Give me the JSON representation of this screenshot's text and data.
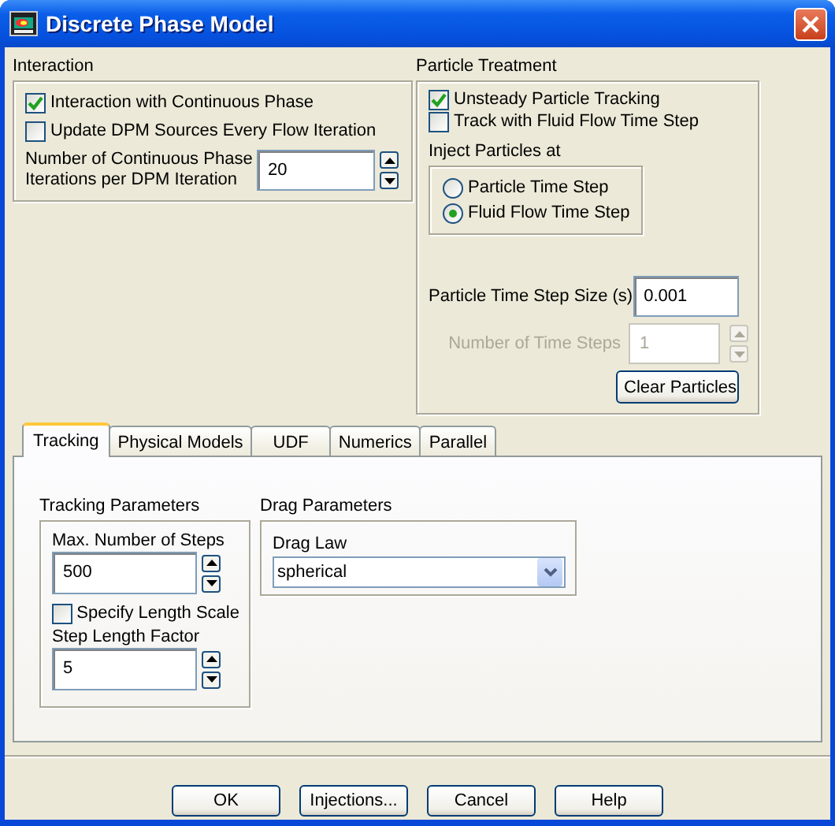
{
  "window": {
    "title": "Discrete Phase Model"
  },
  "interaction": {
    "title": "Interaction",
    "options": [
      {
        "label": "Interaction with Continuous Phase",
        "checked": true
      },
      {
        "label": "Update DPM Sources Every Flow Iteration",
        "checked": false
      }
    ],
    "iterations": {
      "label": "Number of Continuous Phase Iterations per DPM Iteration",
      "value": "20"
    }
  },
  "particle_treatment": {
    "title": "Particle Treatment",
    "options": [
      {
        "label": "Unsteady Particle Tracking",
        "checked": true
      },
      {
        "label": "Track with Fluid Flow Time Step",
        "checked": false
      }
    ],
    "inject": {
      "title": "Inject Particles at",
      "choices": [
        {
          "label": "Particle Time Step",
          "selected": false
        },
        {
          "label": "Fluid Flow Time Step",
          "selected": true
        }
      ]
    },
    "time_step_size": {
      "label": "Particle Time Step Size (s)",
      "value": "0.001"
    },
    "number_of_time_steps": {
      "label": "Number of Time Steps",
      "value": "1",
      "disabled": true
    },
    "clear_button": "Clear Particles"
  },
  "tabs": [
    {
      "label": "Tracking",
      "selected": true
    },
    {
      "label": "Physical Models",
      "selected": false
    },
    {
      "label": "UDF",
      "selected": false
    },
    {
      "label": "Numerics",
      "selected": false
    },
    {
      "label": "Parallel",
      "selected": false
    }
  ],
  "tracking_parameters": {
    "title": "Tracking Parameters",
    "max_steps": {
      "label": "Max. Number of Steps",
      "value": "500"
    },
    "specify_length_scale": {
      "label": "Specify Length Scale",
      "checked": false
    },
    "step_length_factor": {
      "label": "Step Length Factor",
      "value": "5"
    }
  },
  "drag_parameters": {
    "title": "Drag Parameters",
    "drag_law": {
      "label": "Drag Law",
      "value": "spherical"
    }
  },
  "buttons": [
    "OK",
    "Injections...",
    "Cancel",
    "Help"
  ]
}
